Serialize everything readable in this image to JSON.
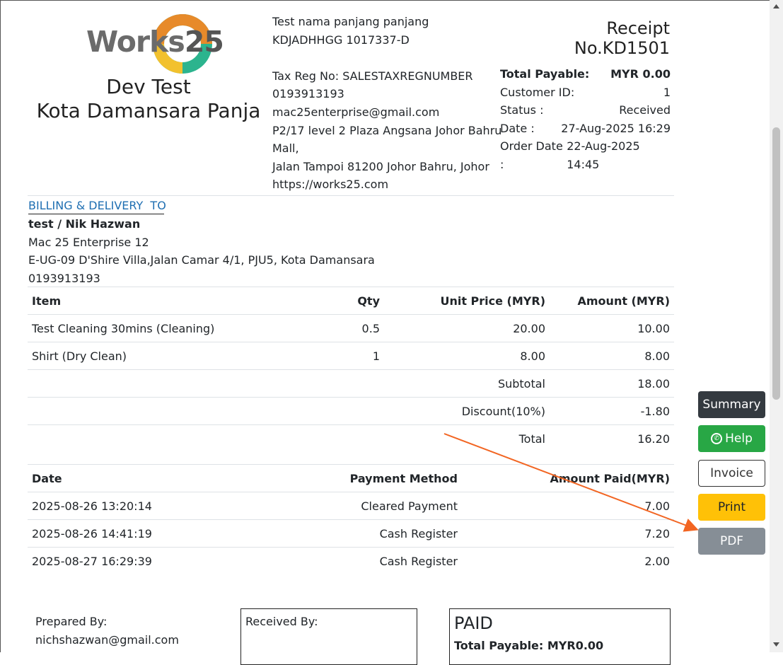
{
  "logo": {
    "word": "Works",
    "num": "25",
    "colors": [
      "#e78a2a",
      "#2cb48e",
      "#f2c12e",
      "#6b6b6b"
    ]
  },
  "store": {
    "name": "Dev Test",
    "area": "Kota Damansara Panja"
  },
  "company": {
    "lines": [
      "Test nama panjang panjang",
      "KDJADHHGG 1017337-D",
      "",
      "Tax Reg No: SALESTAXREGNUMBER",
      "0193913193",
      "mac25enterprise@gmail.com",
      "P2/17 level 2 Plaza Angsana Johor Bahru",
      "Mall,",
      "Jalan Tampoi 81200 Johor Bahru, Johor",
      "https://works25.com"
    ]
  },
  "receipt": {
    "title": "Receipt",
    "number": "No.KD1501"
  },
  "summary": {
    "total_label": "Total Payable:",
    "total_value": "MYR 0.00",
    "customer_label": "Customer ID:",
    "customer_value": "1",
    "status_label": "Status :",
    "status_value": "Received",
    "date_label": "Date :",
    "date_value": "27-Aug-2025 16:29",
    "order_label": "Order Date :",
    "order_value": "22-Aug-2025 14:45"
  },
  "billing": {
    "heading": "BILLING & DELIVERY  TO",
    "name": "test / Nik Hazwan",
    "company": "Mac 25 Enterprise 12",
    "address": "E-UG-09 D'Shire Villa,Jalan Camar 4/1, PJU5, Kota Damansara",
    "phone": "0193913193"
  },
  "items": {
    "headers": {
      "item": "Item",
      "qty": "Qty",
      "unit": "Unit Price (MYR)",
      "amount": "Amount (MYR)"
    },
    "rows": [
      {
        "item": "Test Cleaning 30mins (Cleaning)",
        "qty": "0.5",
        "unit": "20.00",
        "amount": "10.00"
      },
      {
        "item": "Shirt (Dry Clean)",
        "qty": "1",
        "unit": "8.00",
        "amount": "8.00"
      }
    ],
    "subtotal_label": "Subtotal",
    "subtotal": "18.00",
    "discount_label": "Discount(10%)",
    "discount": "-1.80",
    "total_label": "Total",
    "total": "16.20"
  },
  "payments": {
    "headers": {
      "date": "Date",
      "method": "Payment Method",
      "amount": "Amount Paid(MYR)"
    },
    "rows": [
      {
        "date": "2025-08-26 13:20:14",
        "method": "Cleared Payment",
        "amount": "7.00"
      },
      {
        "date": "2025-08-26 14:41:19",
        "method": "Cash Register",
        "amount": "7.20"
      },
      {
        "date": "2025-08-27 16:29:39",
        "method": "Cash Register",
        "amount": "2.00"
      }
    ]
  },
  "buttons": {
    "summary": "Summary",
    "help": "Help",
    "invoice": "Invoice",
    "print": "Print",
    "pdf": "PDF"
  },
  "footer": {
    "prepared_label": "Prepared By:",
    "prepared_value": "nichshazwan@gmail.com",
    "received_label": "Received By:",
    "paid_label": "PAID",
    "paid_total": "Total Payable: MYR0.00"
  },
  "colors": {
    "link_blue": "#1f6fb2",
    "arrow": "#f26522",
    "summary_btn": "#343a40",
    "help_btn": "#28a745",
    "print_btn": "#ffc107",
    "pdf_btn": "#868e96"
  }
}
